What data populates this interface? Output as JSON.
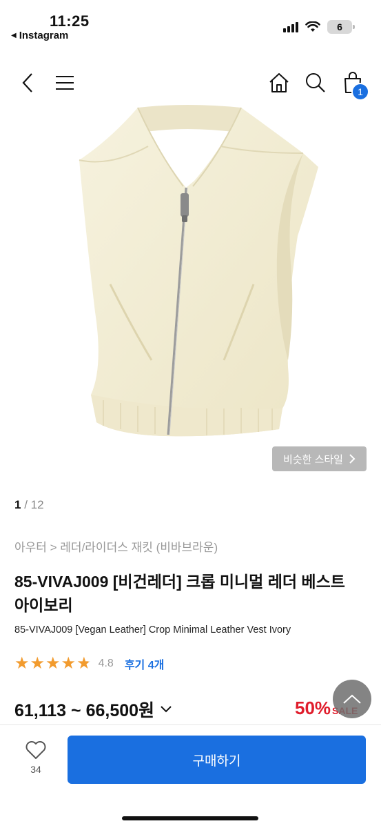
{
  "status_bar": {
    "time": "11:25",
    "back_app": "Instagram",
    "battery": "6"
  },
  "nav": {
    "cart_count": "1"
  },
  "gallery": {
    "similar_style_label": "비슷한 스타일",
    "current": "1",
    "separator": "/",
    "total": "12"
  },
  "product": {
    "breadcrumb": "아우터 > 레더/라이더스 재킷 (비바브라운)",
    "title_ko": "85-VIVAJ009 [비건레더] 크롭 미니멀 레더 베스트 아이보리",
    "title_en": "85-VIVAJ009 [Vegan Leather] Crop Minimal Leather Vest Ivory",
    "rating": "4.8",
    "rating_value": 4.8,
    "review_label": "후기 4개",
    "price": "61,113 ~ 66,500원",
    "discount": "50%",
    "sale_label": "SALE"
  },
  "bottom_bar": {
    "like_count": "34",
    "buy_label": "구매하기"
  },
  "colors": {
    "accent": "#1a6fe0",
    "sale": "#e01d2c",
    "star": "#f29b2e",
    "garment": "#f3eed6"
  }
}
